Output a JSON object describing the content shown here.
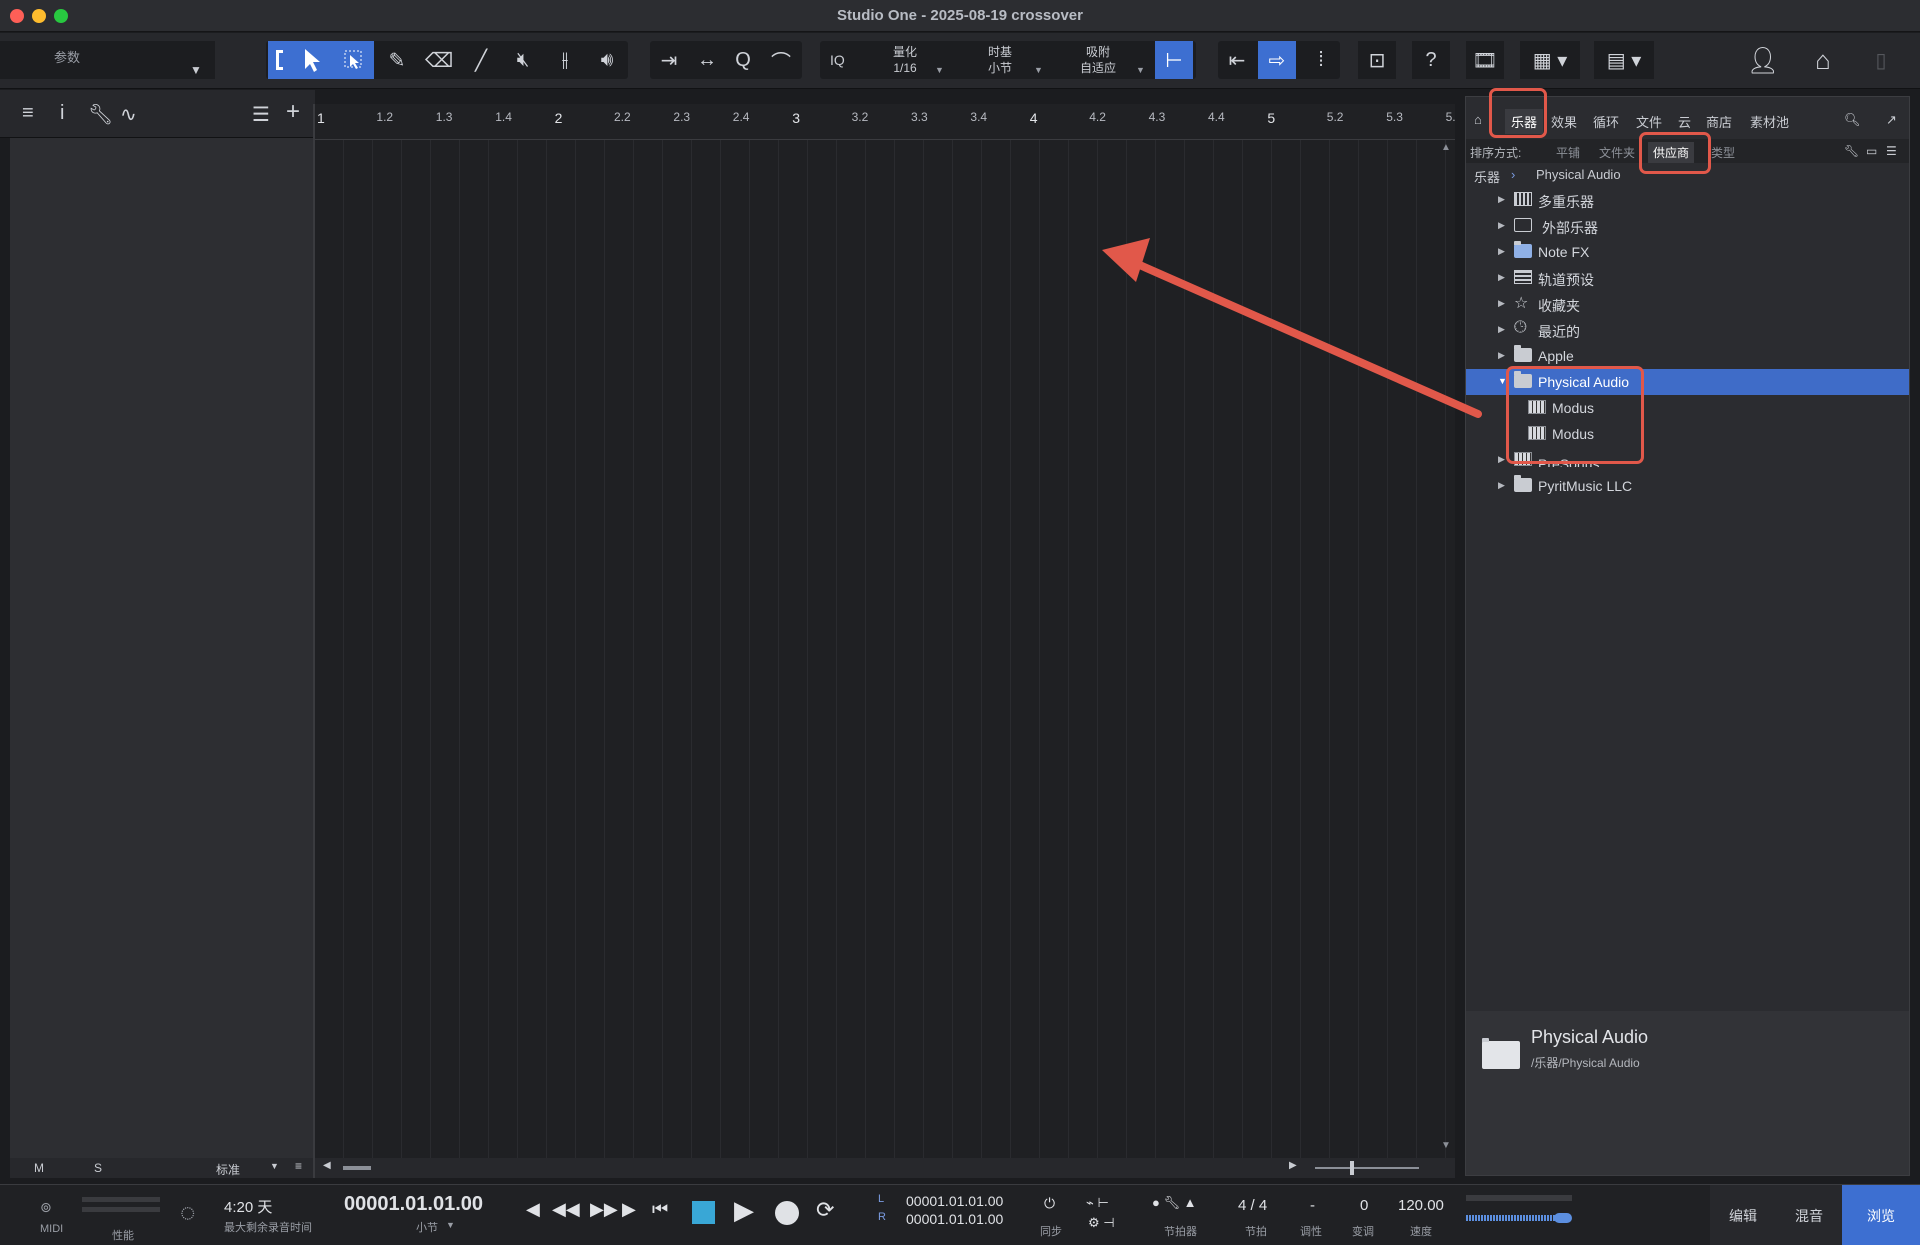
{
  "window": {
    "title": "Studio One - 2025-08-19 crossover"
  },
  "toolbar": {
    "params_label": "参数",
    "quantize": {
      "label": "量化",
      "value": "1/16"
    },
    "timebase": {
      "label": "时基",
      "value": "小节"
    },
    "snap": {
      "label": "吸附",
      "value": "自适应"
    },
    "iq_label": "IQ",
    "help_label": "?"
  },
  "inspector_footer": {
    "m": "M",
    "s": "S",
    "mode": "标准"
  },
  "ruler": {
    "labels": [
      "1",
      "1.2",
      "1.3",
      "1.4",
      "2",
      "2.2",
      "2.3",
      "2.4",
      "3",
      "3.2",
      "3.3",
      "3.4",
      "4",
      "4.2",
      "4.3",
      "4.4",
      "5",
      "5.2",
      "5.3",
      "5."
    ]
  },
  "browser": {
    "tabs": [
      "乐器",
      "效果",
      "循环",
      "文件",
      "云",
      "商店",
      "素材池"
    ],
    "active_tab": "乐器",
    "sort": {
      "label": "排序方式:",
      "options": [
        "平铺",
        "文件夹",
        "供应商",
        "类型"
      ],
      "active": "供应商"
    },
    "breadcrumb": {
      "root": "乐器",
      "current": "Physical Audio"
    },
    "tree": [
      {
        "label": "多重乐器"
      },
      {
        "label": "外部乐器"
      },
      {
        "label": "Note FX"
      },
      {
        "label": "轨道预设"
      },
      {
        "label": "收藏夹"
      },
      {
        "label": "最近的"
      },
      {
        "label": "Apple"
      },
      {
        "label": "Physical Audio"
      },
      {
        "label": "Modus"
      },
      {
        "label": "Modus"
      },
      {
        "label": "PreSonus"
      },
      {
        "label": "PyritMusic LLC"
      }
    ],
    "info": {
      "title": "Physical Audio",
      "path": "/乐器/Physical Audio"
    }
  },
  "transport": {
    "midi_label": "MIDI",
    "performance_label": "性能",
    "record_time": "4:20 天",
    "record_time_label": "最大剩余录音时间",
    "position": "00001.01.01.00",
    "position_unit": "小节",
    "loop_l_label": "L",
    "loop_r_label": "R",
    "loop_start": "00001.01.01.00",
    "loop_end": "00001.01.01.00",
    "sync_label": "同步",
    "metronome_label": "节拍器",
    "time_signature": "4 / 4",
    "time_signature_label": "节拍",
    "key": "-",
    "key_label": "调性",
    "transpose": "0",
    "transpose_label": "变调",
    "tempo": "120.00",
    "tempo_label": "速度"
  },
  "modes": [
    "编辑",
    "混音",
    "浏览"
  ],
  "active_mode": "浏览",
  "colors": {
    "accent": "#3d6fd1",
    "annotation": "#e1584a",
    "selection": "#3f6cc8"
  }
}
